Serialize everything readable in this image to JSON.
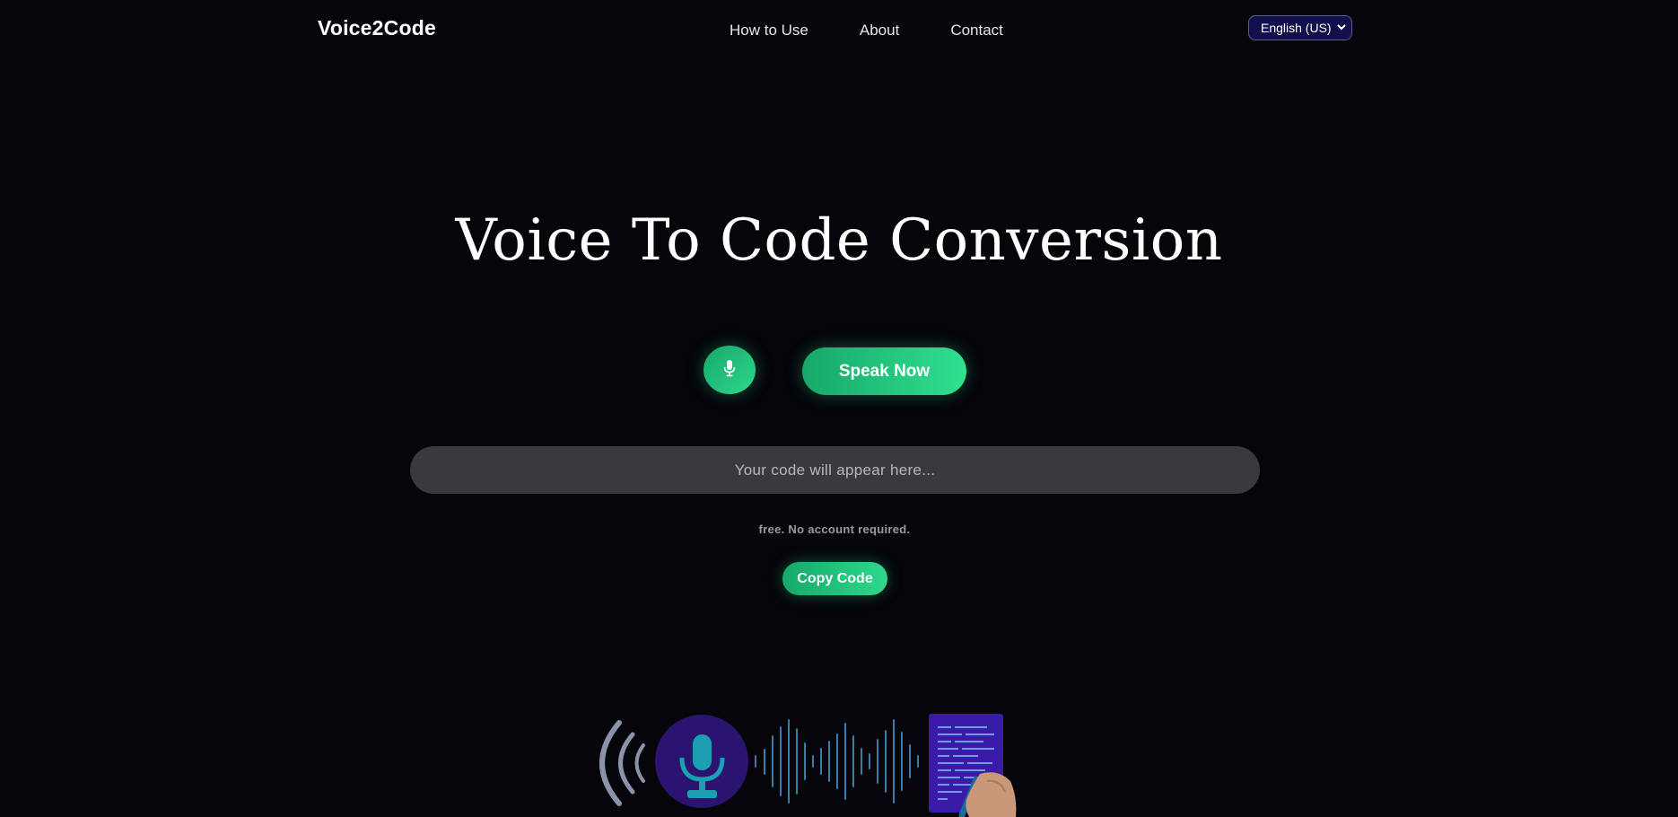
{
  "header": {
    "brand": "Voice2Code",
    "nav": [
      {
        "label": "How to Use"
      },
      {
        "label": "About"
      },
      {
        "label": "Contact"
      }
    ],
    "language": {
      "selected": "English (US)"
    }
  },
  "hero": {
    "title": "Voice To Code Conversion",
    "mic_icon": "microphone-icon",
    "speak_label": "Speak Now",
    "output_placeholder": "Your code will appear here...",
    "note": "free. No account required.",
    "copy_label": "Copy Code"
  },
  "colors": {
    "background": "#05050a",
    "accent_green_start": "#17a86a",
    "accent_green_end": "#2ed88c",
    "output_bg": "#3a3a3e",
    "language_select_bg": "#12104a",
    "illustration_purple": "#2a1470",
    "illustration_teal": "#1a8ea0"
  }
}
